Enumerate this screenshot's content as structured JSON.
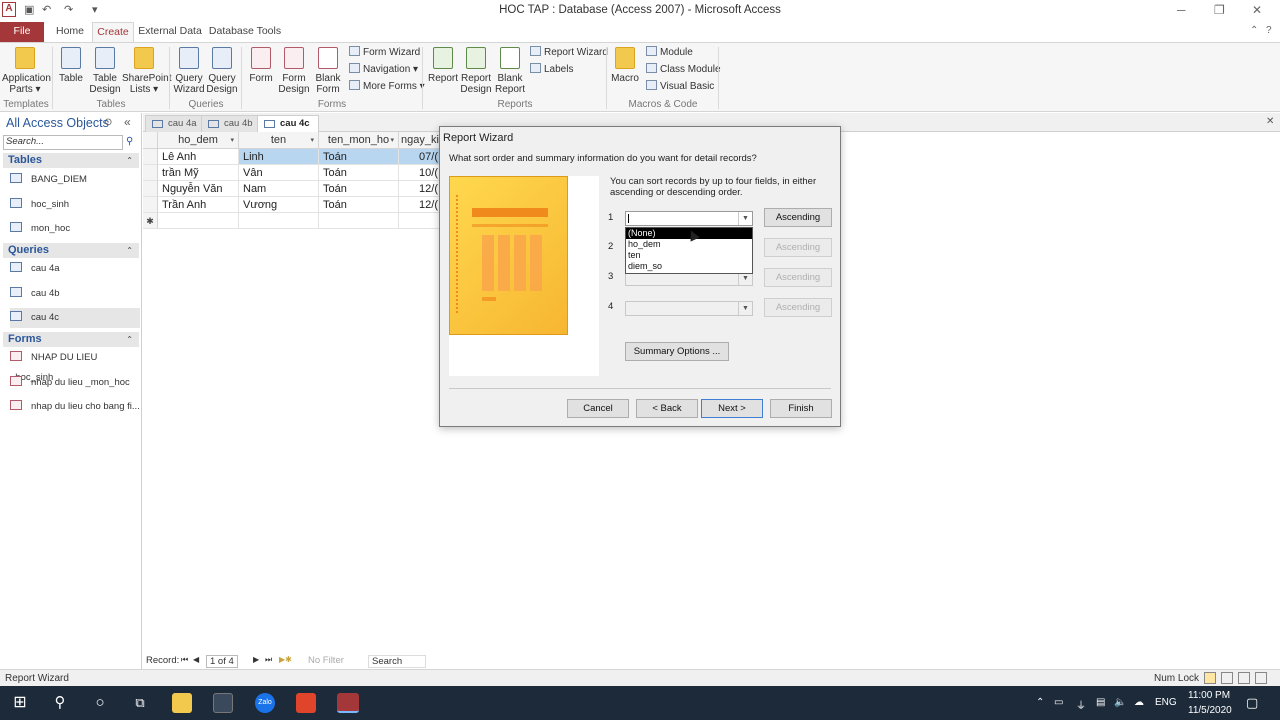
{
  "window": {
    "title": "HOC TAP : Database (Access 2007)  -  Microsoft Access",
    "logo": "A",
    "help_icon": "?"
  },
  "tabs": [
    "File",
    "Home",
    "Create",
    "External Data",
    "Database Tools"
  ],
  "ribbon": {
    "templates": {
      "label": "Templates",
      "buttons": [
        "Application Parts ▾"
      ]
    },
    "tables": {
      "label": "Tables",
      "buttons": [
        "Table",
        "Table Design",
        "SharePoint Lists ▾"
      ]
    },
    "queries": {
      "label": "Queries",
      "buttons": [
        "Query Wizard",
        "Query Design"
      ]
    },
    "forms": {
      "label": "Forms",
      "buttons": [
        "Form",
        "Form Design",
        "Blank Form"
      ],
      "small": [
        "Form Wizard",
        "Navigation ▾",
        "More Forms ▾"
      ]
    },
    "reports": {
      "label": "Reports",
      "buttons": [
        "Report",
        "Report Design",
        "Blank Report"
      ],
      "small": [
        "Report Wizard",
        "Labels"
      ]
    },
    "macros": {
      "label": "Macros & Code",
      "buttons": [
        "Macro"
      ],
      "small": [
        "Module",
        "Class Module",
        "Visual Basic"
      ]
    }
  },
  "nav": {
    "title": "All Access Objects",
    "search_placeholder": "Search...",
    "tables": {
      "label": "Tables",
      "items": [
        "BANG_DIEM",
        "hoc_sinh",
        "mon_hoc"
      ]
    },
    "queries": {
      "label": "Queries",
      "items": [
        "cau 4a",
        "cau 4b",
        "cau 4c"
      ]
    },
    "forms": {
      "label": "Forms",
      "items": [
        "NHAP DU LIEU _hoc_sinh",
        "nhap du lieu _mon_hoc",
        "nhap du lieu cho bang fi..."
      ]
    }
  },
  "doc_tabs": [
    "cau 4a",
    "cau 4b",
    "cau 4c"
  ],
  "grid": {
    "columns": [
      "ho_dem",
      "ten",
      "ten_mon_ho",
      "ngay_ki"
    ],
    "rows": [
      [
        "Lê Anh",
        "Linh",
        "Toán",
        "07/("
      ],
      [
        "trần Mỹ",
        "Vân",
        "Toán",
        "10/("
      ],
      [
        "Nguyễn Văn",
        "Nam",
        "Toán",
        "12/("
      ],
      [
        "Trần Anh",
        "Vương",
        "Toán",
        "12/("
      ]
    ],
    "new_row_marker": "✱"
  },
  "recnav": {
    "label": "Record:",
    "position": "1 of 4",
    "filter": "No Filter",
    "search": "Search"
  },
  "status": {
    "left": "Report Wizard",
    "numlock": "Num Lock"
  },
  "wizard": {
    "title": "Report Wizard",
    "question": "What sort order and summary information do you want for detail records?",
    "description": "You can sort records by up to four fields, in either ascending or descending order.",
    "sort_numbers": [
      "1",
      "2",
      "3",
      "4"
    ],
    "sort_buttons": [
      "Ascending",
      "Ascending",
      "Ascending",
      "Ascending"
    ],
    "dropdown_options": [
      "(None)",
      "ho_dem",
      "ten",
      "diem_so"
    ],
    "summary_button": "Summary Options ...",
    "cancel": "Cancel",
    "back": "< Back",
    "next": "Next >",
    "finish": "Finish"
  },
  "taskbar": {
    "lang": "ENG",
    "time": "11:00 PM",
    "date": "11/5/2020",
    "app_zalo": "Zalo"
  }
}
